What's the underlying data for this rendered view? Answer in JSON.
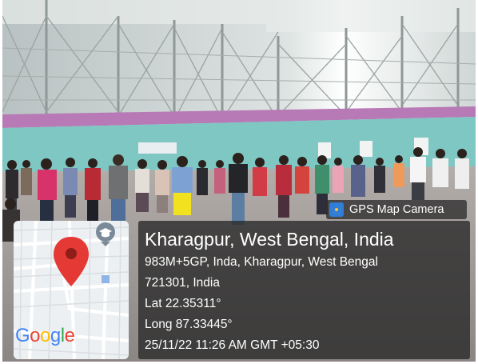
{
  "stamp": {
    "app_name": "GPS Map Camera",
    "location_title": "Kharagpur, West Bengal, India",
    "address_line_1": "983M+5GP, Inda, Kharagpur, West Bengal",
    "address_line_2": "721301, India",
    "latitude": "Lat 22.35311°",
    "longitude": "Long 87.33445°",
    "datetime": "25/11/22 11:26 AM GMT +05:30"
  },
  "map": {
    "brand": "Google",
    "brand_letters": [
      "G",
      "o",
      "o",
      "g",
      "l",
      "e"
    ],
    "brand_colors": [
      "#4285F4",
      "#EA4335",
      "#FBBC05",
      "#4285F4",
      "#34A853",
      "#EA4335"
    ],
    "pin_color": "#E53935",
    "icons": [
      "location-pin-icon",
      "graduation-cap-icon",
      "google-logo"
    ]
  },
  "scene": {
    "colors": {
      "roof": "#ecefee",
      "wall_upper": "#c7cfcc",
      "purple_band": "#b77ab6",
      "teal_wall": "#7fc7c3",
      "floor": "#9a9696"
    }
  }
}
